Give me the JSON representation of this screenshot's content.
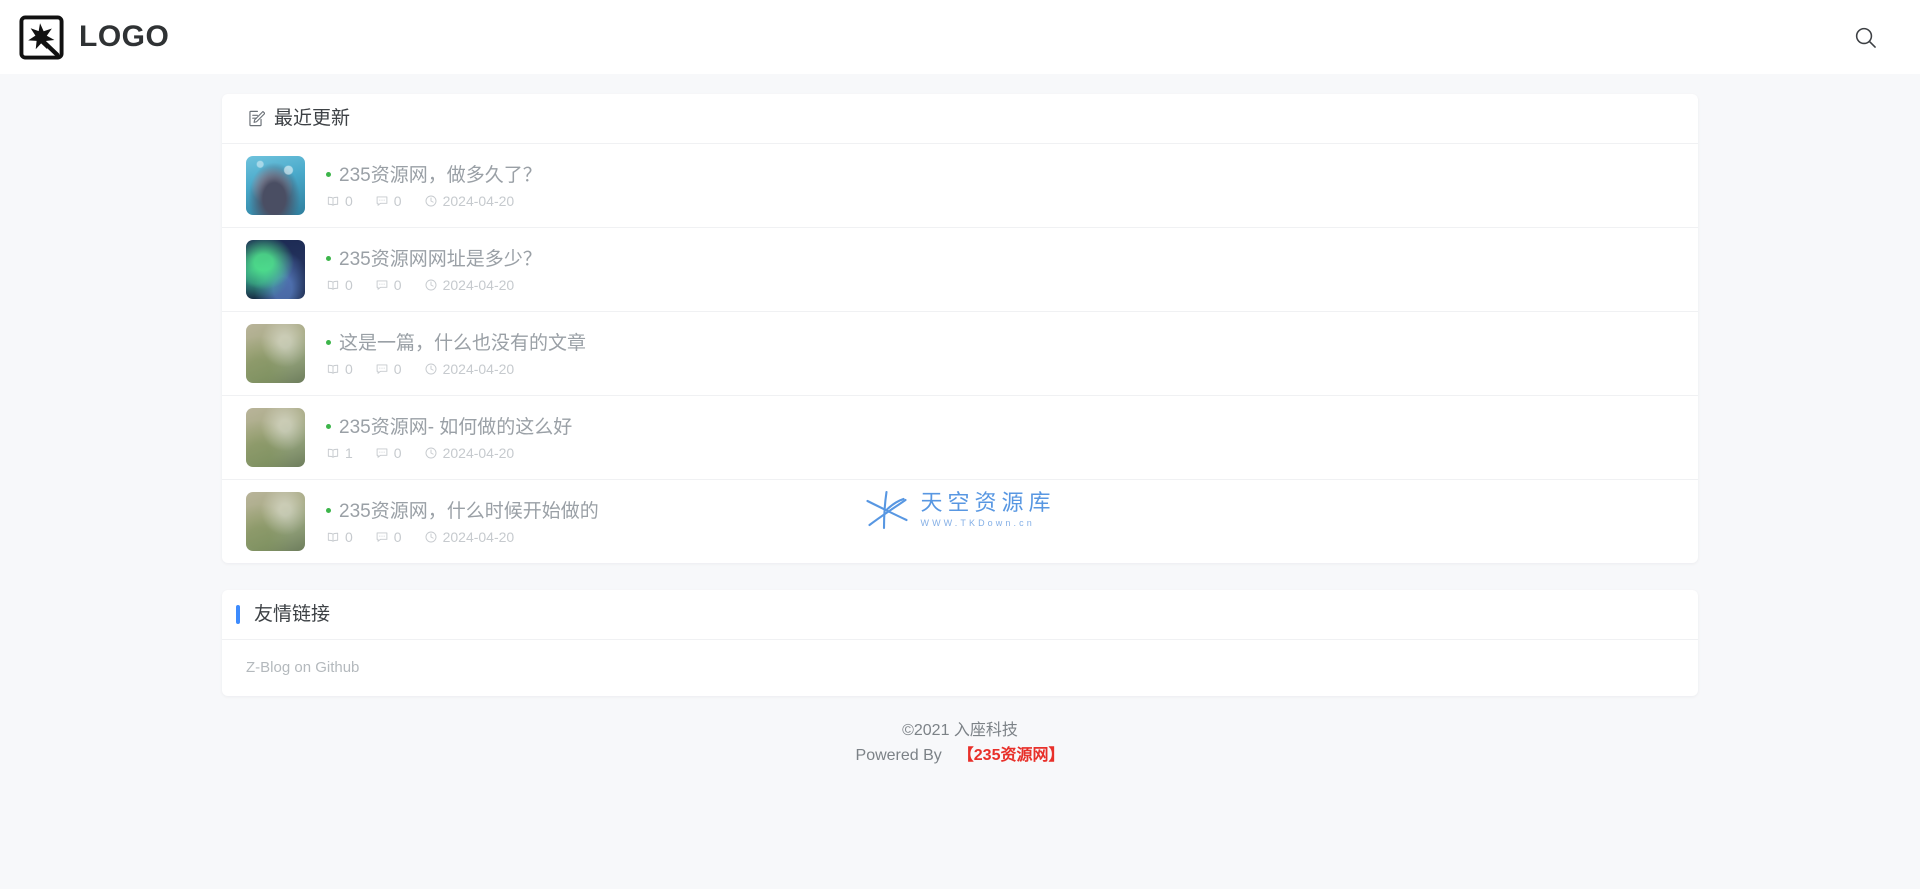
{
  "header": {
    "logo_icon": "magic-wand-icon",
    "logo_text": "LOGO",
    "search_icon": "search-icon"
  },
  "recent": {
    "icon": "document-edit-icon",
    "title": "最近更新",
    "posts": [
      {
        "title": "235资源网，做多久了？",
        "views": "0",
        "comments": "0",
        "date": "2024-04-20",
        "thumb": "anime-character-thumbnail"
      },
      {
        "title": "235资源网网址是多少？",
        "views": "0",
        "comments": "0",
        "date": "2024-04-20",
        "thumb": "aurora-borealis-thumbnail"
      },
      {
        "title": "这是一篇，什么也没有的文章",
        "views": "0",
        "comments": "0",
        "date": "2024-04-20",
        "thumb": "grass-meadow-thumbnail"
      },
      {
        "title": "235资源网- 如何做的这么好",
        "views": "1",
        "comments": "0",
        "date": "2024-04-20",
        "thumb": "grass-meadow-thumbnail"
      },
      {
        "title": "235资源网，什么时候开始做的",
        "views": "0",
        "comments": "0",
        "date": "2024-04-20",
        "thumb": "grass-meadow-thumbnail"
      }
    ]
  },
  "friend_links": {
    "title": "友情链接",
    "accent_color": "#3d8bfd",
    "links": [
      {
        "label": "Z-Blog on Github"
      }
    ]
  },
  "watermark": {
    "main": "天空资源库",
    "sub": "WWW.TKDown.cn",
    "color": "#4a8fe0"
  },
  "footer": {
    "copyright": "©2021  入座科技",
    "powered_label": "Powered By",
    "powered_link": "【235资源网】",
    "powered_link_color": "#e8302a"
  }
}
